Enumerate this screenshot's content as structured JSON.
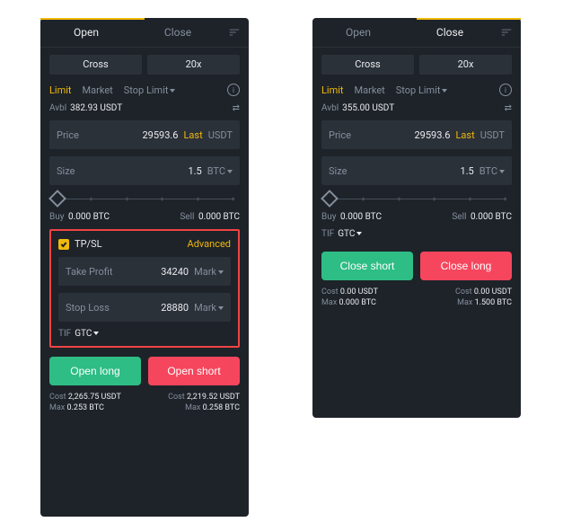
{
  "left": {
    "tab_open": "Open",
    "tab_close": "Close",
    "chip_margin": "Cross",
    "chip_lev": "20x",
    "ot_limit": "Limit",
    "ot_market": "Market",
    "ot_stop": "Stop Limit",
    "avbl_lbl": "Avbl",
    "avbl_val": "382.93 USDT",
    "price_lbl": "Price",
    "price_val": "29593.6",
    "last": "Last",
    "price_unit": "USDT",
    "size_lbl": "Size",
    "size_val": "1.5",
    "size_unit": "BTC",
    "buy_lbl": "Buy",
    "buy_val": "0.000 BTC",
    "sell_lbl": "Sell",
    "sell_val": "0.000 BTC",
    "tpsl_lbl": "TP/SL",
    "adv": "Advanced",
    "tp_lbl": "Take Profit",
    "tp_val": "34240",
    "tp_trig": "Mark",
    "sl_lbl": "Stop Loss",
    "sl_val": "28880",
    "sl_trig": "Mark",
    "tif_lbl": "TIF",
    "tif_val": "GTC",
    "btn_long": "Open long",
    "btn_short": "Open short",
    "cost_lbl": "Cost",
    "max_lbl": "Max",
    "cost_long": "2,265.75 USDT",
    "max_long": "0.253 BTC",
    "cost_short": "2,219.52 USDT",
    "max_short": "0.258 BTC"
  },
  "right": {
    "tab_open": "Open",
    "tab_close": "Close",
    "chip_margin": "Cross",
    "chip_lev": "20x",
    "ot_limit": "Limit",
    "ot_market": "Market",
    "ot_stop": "Stop Limit",
    "avbl_lbl": "Avbl",
    "avbl_val": "355.00 USDT",
    "price_lbl": "Price",
    "price_val": "29593.6",
    "last": "Last",
    "price_unit": "USDT",
    "size_lbl": "Size",
    "size_val": "1.5",
    "size_unit": "BTC",
    "buy_lbl": "Buy",
    "buy_val": "0.000 BTC",
    "sell_lbl": "Sell",
    "sell_val": "0.000 BTC",
    "tif_lbl": "TIF",
    "tif_val": "GTC",
    "btn_cs": "Close short",
    "btn_cl": "Close long",
    "cost_lbl": "Cost",
    "max_lbl": "Max",
    "cost_cs": "0.00 USDT",
    "max_cs": "0.000 BTC",
    "cost_cl": "0.00 USDT",
    "max_cl": "1.500 BTC"
  }
}
